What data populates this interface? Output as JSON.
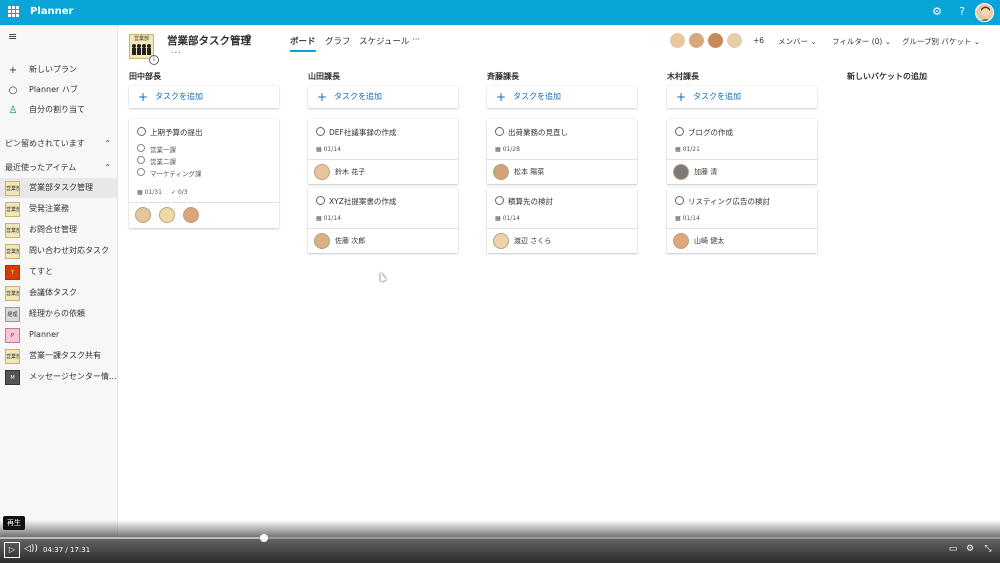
{
  "app": {
    "name": "Planner"
  },
  "topbar_icons": {
    "settings": "⚙",
    "help": "?"
  },
  "sidebar": {
    "menu_icon": "≡",
    "nav": [
      {
        "icon": "+",
        "label": "新しいプラン"
      },
      {
        "icon": "○",
        "label": "Planner ハブ"
      },
      {
        "icon": "♙",
        "label": "自分の割り当て"
      }
    ],
    "pinned_header": "ピン留めされています",
    "recent_header": "最近使ったアイテム",
    "recent": [
      {
        "label": "営業部タスク管理",
        "thumb": "営業部",
        "active": true
      },
      {
        "label": "受発注業務",
        "thumb": "営業部"
      },
      {
        "label": "お問合せ管理",
        "thumb": "営業部"
      },
      {
        "label": "問い合わせ対応タスク",
        "thumb": "営業部"
      },
      {
        "label": "てすと",
        "thumb": "T"
      },
      {
        "label": "会議体タスク",
        "thumb": "営業部"
      },
      {
        "label": "経理からの依頼",
        "thumb": "経理"
      },
      {
        "label": "Planner",
        "thumb": "P"
      },
      {
        "label": "営業一課タスク共有",
        "thumb": "営業部"
      },
      {
        "label": "メッセージセンター情...",
        "thumb": "M"
      }
    ]
  },
  "plan": {
    "title": "営業部タスク管理",
    "thumb_label": "営業部",
    "more": "...",
    "tabs": [
      "ボード",
      "グラフ",
      "スケジュール",
      "···"
    ],
    "members_extra": "+6",
    "members_label": "メンバー",
    "filter_label": "フィルター (0)",
    "group_label": "グループ別 バケット"
  },
  "board": {
    "add_task_label": "タスクを追加",
    "new_bucket_label": "新しいバケットの追加",
    "buckets": [
      {
        "name": "田中部長",
        "cards": [
          {
            "title": "上期予算の提出",
            "subtasks": [
              "営業一課",
              "営業二課",
              "マーケティング課"
            ],
            "date": "01/31",
            "checklist": "0/3",
            "assignee": ""
          }
        ]
      },
      {
        "name": "山田課長",
        "cards": [
          {
            "title": "DEF社議事録の作成",
            "date": "01/14",
            "assignee": "鈴木 花子"
          },
          {
            "title": "XYZ社提案書の作成",
            "date": "01/14",
            "assignee": "佐藤 次郎"
          }
        ]
      },
      {
        "name": "斉藤課長",
        "cards": [
          {
            "title": "出荷業務の見直し",
            "date": "01/28",
            "assignee": "松本 陽菜"
          },
          {
            "title": "積算先の検討",
            "date": "01/14",
            "assignee": "渡辺 さくら"
          }
        ]
      },
      {
        "name": "木村課長",
        "cards": [
          {
            "title": "ブログの作成",
            "date": "01/21",
            "assignee": "加藤 清"
          },
          {
            "title": "リスティング広告の検討",
            "date": "01/14",
            "assignee": "山崎 健太"
          }
        ]
      }
    ]
  },
  "player": {
    "tooltip": "再生",
    "play_icon": "▷",
    "current_time": "04:37",
    "separator": "/",
    "duration": "17:31",
    "progress": 0.264,
    "volume_icon": "◁))",
    "cc_icon": "▭",
    "settings_icon": "⚙",
    "fullscreen_icon": "⤡"
  }
}
